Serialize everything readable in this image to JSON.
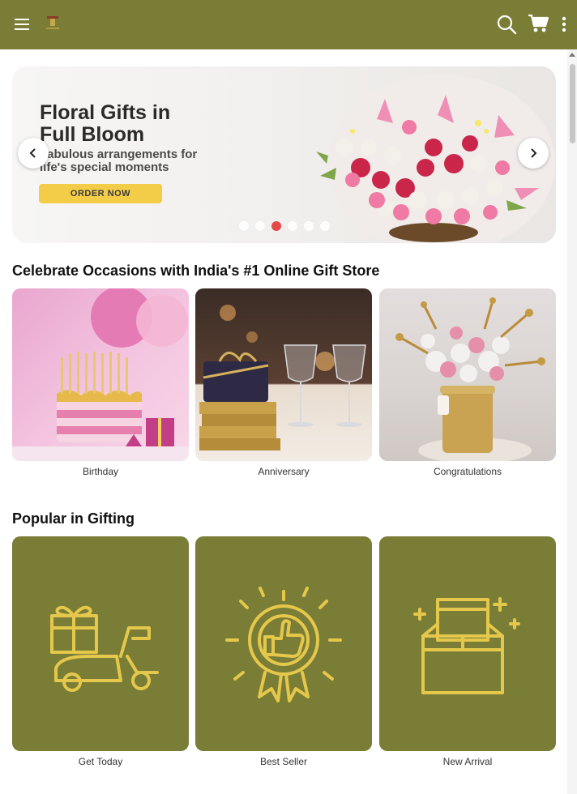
{
  "header": {
    "background": "#7a7d36",
    "menu_icon": "menu-icon",
    "logo": "logo",
    "search_icon": "search-icon",
    "cart_icon": "cart-icon",
    "more_icon": "more-vertical-icon"
  },
  "banner": {
    "title_line1": "Floral Gifts in",
    "title_line2": "Full Bloom",
    "subtitle_line1": "Fabulous arrangements for",
    "subtitle_line2": "life's special moments",
    "cta": "ORDER NOW",
    "cta_color": "#f4cd48",
    "slide_count": 6,
    "active_slide": 3
  },
  "occasions": {
    "title": "Celebrate Occasions with India's #1 Online Gift Store",
    "items": [
      {
        "label": "Birthday"
      },
      {
        "label": "Anniversary"
      },
      {
        "label": "Congratulations"
      }
    ]
  },
  "popular": {
    "title": "Popular in Gifting",
    "tile_color": "#7a7d36",
    "icon_color": "#e5c84b",
    "items": [
      {
        "label": "Get Today",
        "icon": "scooter-delivery-icon"
      },
      {
        "label": "Best Seller",
        "icon": "thumbs-up-badge-icon"
      },
      {
        "label": "New Arrival",
        "icon": "new-box-icon"
      }
    ]
  }
}
